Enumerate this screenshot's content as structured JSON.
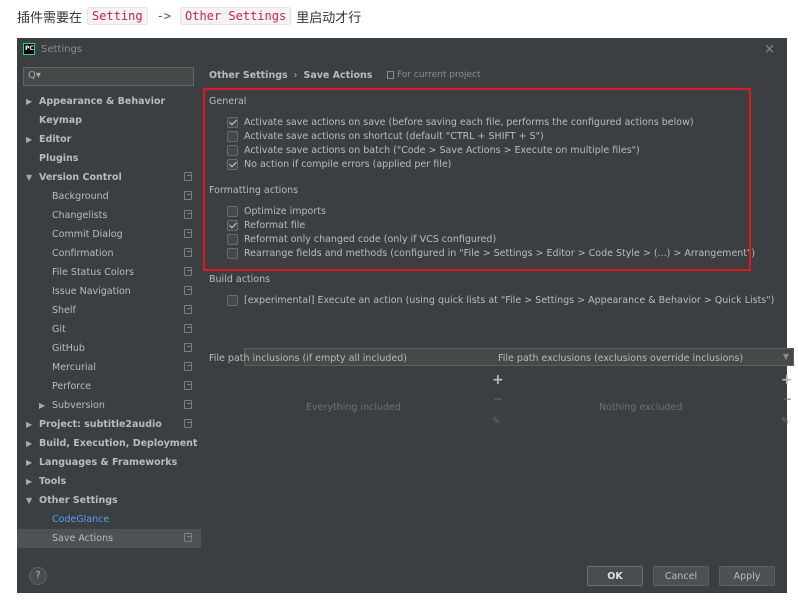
{
  "caption": {
    "prefix": "插件需要在",
    "code1": "Setting",
    "arrow": "->",
    "code2": "Other Settings",
    "suffix": "里启动才行"
  },
  "window": {
    "app_icon": "PC",
    "title": "Settings",
    "close": "×"
  },
  "search": {
    "placeholder": "Q▾",
    "icon": "search-icon"
  },
  "sidebar": {
    "items": [
      {
        "label": "Appearance & Behavior",
        "arrow": "▶"
      },
      {
        "label": "Keymap",
        "arrow": ""
      },
      {
        "label": "Editor",
        "arrow": "▶"
      },
      {
        "label": "Plugins",
        "arrow": ""
      },
      {
        "label": "Version Control",
        "arrow": "▼"
      },
      {
        "label": "Background"
      },
      {
        "label": "Changelists"
      },
      {
        "label": "Commit Dialog"
      },
      {
        "label": "Confirmation"
      },
      {
        "label": "File Status Colors"
      },
      {
        "label": "Issue Navigation"
      },
      {
        "label": "Shelf"
      },
      {
        "label": "Git"
      },
      {
        "label": "GitHub"
      },
      {
        "label": "Mercurial"
      },
      {
        "label": "Perforce"
      },
      {
        "label": "Subversion",
        "arrow": "▶"
      },
      {
        "label": "Project: subtitle2audio",
        "arrow": "▶"
      },
      {
        "label": "Build, Execution, Deployment",
        "arrow": "▶"
      },
      {
        "label": "Languages & Frameworks",
        "arrow": "▶"
      },
      {
        "label": "Tools",
        "arrow": "▶"
      },
      {
        "label": "Other Settings",
        "arrow": "▼"
      },
      {
        "label": "CodeGlance"
      },
      {
        "label": "Save Actions"
      }
    ]
  },
  "breadcrumb": {
    "parent": "Other Settings",
    "sep": "›",
    "current": "Save Actions"
  },
  "scope": "For current project",
  "general": {
    "title": "General",
    "options": [
      {
        "label": "Activate save actions on save (before saving each file, performs the configured actions below)",
        "checked": true
      },
      {
        "label": "Activate save actions on shortcut (default \"CTRL + SHIFT + S\")",
        "checked": false
      },
      {
        "label": "Activate save actions on batch (\"Code > Save Actions > Execute on multiple files\")",
        "checked": false
      },
      {
        "label": "No action if compile errors (applied per file)",
        "checked": true
      }
    ]
  },
  "formatting": {
    "title": "Formatting actions",
    "options": [
      {
        "label": "Optimize imports",
        "checked": false
      },
      {
        "label": "Reformat file",
        "checked": true
      },
      {
        "label": "Reformat only changed code (only if VCS configured)",
        "checked": false
      },
      {
        "label": "Rearrange fields and methods (configured in \"File > Settings > Editor > Code Style > (...) > Arrangement\")",
        "checked": false
      }
    ]
  },
  "build": {
    "title": "Build actions",
    "option": {
      "label": "[experimental] Execute an action (using quick lists at \"File > Settings > Appearance & Behavior > Quick Lists\")",
      "checked": false
    },
    "dropdown_value": ""
  },
  "inclusions": {
    "title": "File path inclusions (if empty all included)",
    "empty": "Everything included"
  },
  "exclusions": {
    "title": "File path exclusions (exclusions override inclusions)",
    "empty": "Nothing excluded"
  },
  "footer": {
    "help": "?",
    "ok": "OK",
    "cancel": "Cancel",
    "apply": "Apply"
  },
  "colors": {
    "window_bg": "#3c3f41",
    "highlight_border": "#e0191e",
    "link": "#589df6",
    "selected_bg": "#4e5254"
  }
}
